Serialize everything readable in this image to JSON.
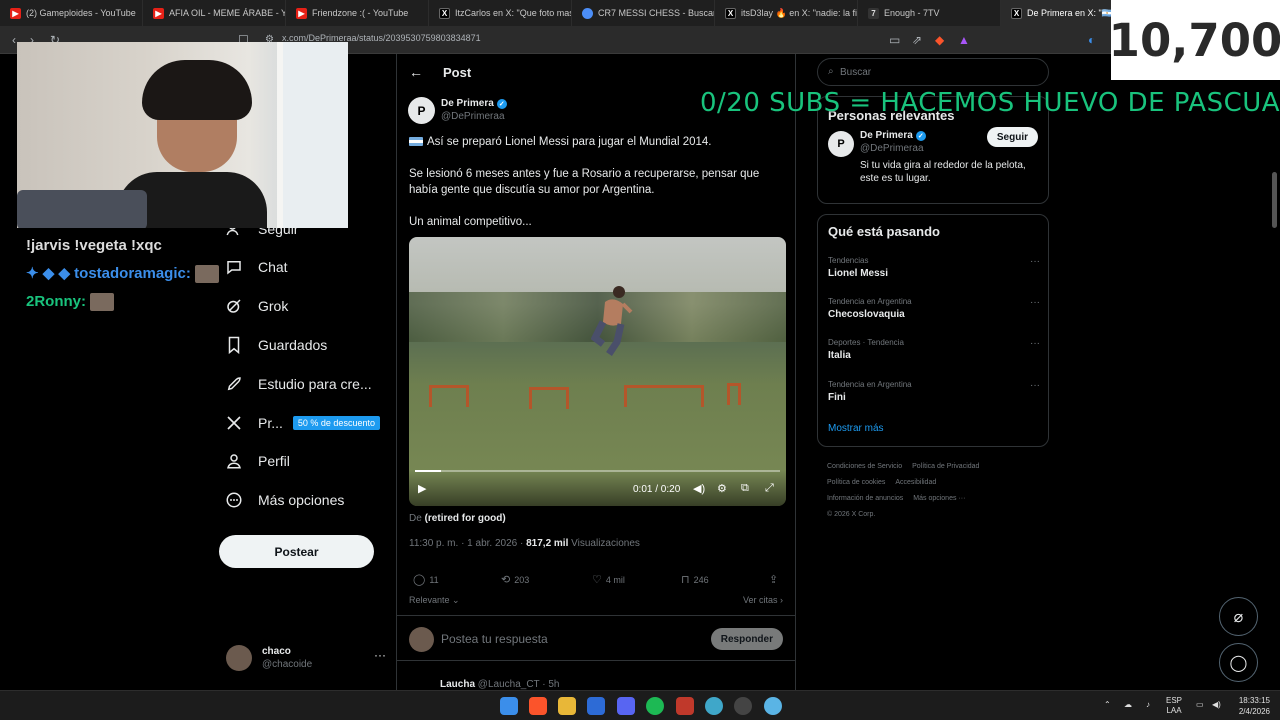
{
  "browser": {
    "tabs": [
      {
        "title": "(2) Gameploides - YouTube",
        "icon": "youtube-icon"
      },
      {
        "title": "AFIA OIL - MEME ÁRABE - You",
        "icon": "youtube-icon"
      },
      {
        "title": "Friendzone :( - YouTube",
        "icon": "youtube-icon"
      },
      {
        "title": "ItzCarlos en X: \"Que foto mas l",
        "icon": "x-icon"
      },
      {
        "title": "CR7 MESSI CHESS - Buscar con",
        "icon": "chess-icon"
      },
      {
        "title": "itsD3lay 🔥 en X: \"nadie: la fila",
        "icon": "x-icon"
      },
      {
        "title": "Enough - 7TV",
        "icon": "7tv-icon"
      },
      {
        "title": "De Primera en X: \"🇦🇷 Así s",
        "icon": "x-icon"
      }
    ],
    "url": "x.com/DePrimeraa/status/2039530759803834871"
  },
  "nav": {
    "items": [
      {
        "label": "Seguir",
        "icon": "follow-icon"
      },
      {
        "label": "Chat",
        "icon": "chat-icon"
      },
      {
        "label": "Grok",
        "icon": "grok-icon"
      },
      {
        "label": "Guardados",
        "icon": "bookmark-icon"
      },
      {
        "label": "Estudio para cre...",
        "icon": "rocket-icon"
      },
      {
        "label": "Pr...",
        "icon": "x-logo-icon",
        "badge": "50 % de descuento"
      },
      {
        "label": "Perfil",
        "icon": "profile-icon"
      },
      {
        "label": "Más opciones",
        "icon": "more-icon"
      }
    ],
    "post_button": "Postear",
    "account": {
      "name": "chaco",
      "handle": "@chacoide"
    }
  },
  "post": {
    "header": "Post",
    "author": {
      "name": "De Primera",
      "handle": "@DePrimeraa"
    },
    "line1": "Así se preparó Lionel Messi para jugar el Mundial 2014.",
    "line2": "Se lesionó 6 meses antes y fue a Rosario a recuperarse, pensar que había gente que discutía su amor por Argentina.",
    "line3": "Un animal competitivo...",
    "video_time": "0:01 / 0:20",
    "video_progress": 0.07,
    "byline_prefix": "De",
    "byline_name": "(retired for good)",
    "timestamp": "11:30 p. m. · 1 abr. 2026 ·",
    "views": "817,2 mil",
    "views_label": "Visualizaciones",
    "replies": "11",
    "reposts": "203",
    "likes": "4 mil",
    "bookmarks": "246",
    "sort": "Relevante",
    "quotes": "Ver citas",
    "reply_placeholder": "Postea tu respuesta",
    "reply_button": "Responder",
    "next_reply_name": "Laucha",
    "next_reply_meta": "@Laucha_CT · 5h"
  },
  "sidebar": {
    "search_placeholder": "Buscar",
    "relevant_title": "Personas relevantes",
    "relevant": {
      "name": "De Primera",
      "handle": "@DePrimeraa",
      "bio": "Si tu vida gira al rededor de la pelota, este es tu lugar.",
      "follow": "Seguir"
    },
    "trends_title": "Qué está pasando",
    "trends": [
      {
        "category": "Tendencias",
        "name": "Lionel Messi"
      },
      {
        "category": "Tendencia en Argentina",
        "name": "Checoslovaquia"
      },
      {
        "category": "Deportes · Tendencia",
        "name": "Italia"
      },
      {
        "category": "Tendencia en Argentina",
        "name": "Fini"
      }
    ],
    "show_more": "Mostrar más",
    "footer": [
      "Condiciones de Servicio",
      "Política de Privacidad",
      "Política de cookies",
      "Accesibilidad",
      "Información de anuncios",
      "Más opciones ···",
      "© 2026 X Corp."
    ]
  },
  "stream": {
    "counter": "10,700",
    "subs_text": "0/20 SUBS = HACEMOS HUEVO DE PASCUA",
    "chat_line1": "!jarvis !vegeta !xqc",
    "chat_user1": "tostadoramagic:",
    "chat_user2": "2Ronny:"
  },
  "taskbar": {
    "lang1": "ESP",
    "lang2": "LAA",
    "time": "18:33:15",
    "date": "2/4/2026"
  }
}
